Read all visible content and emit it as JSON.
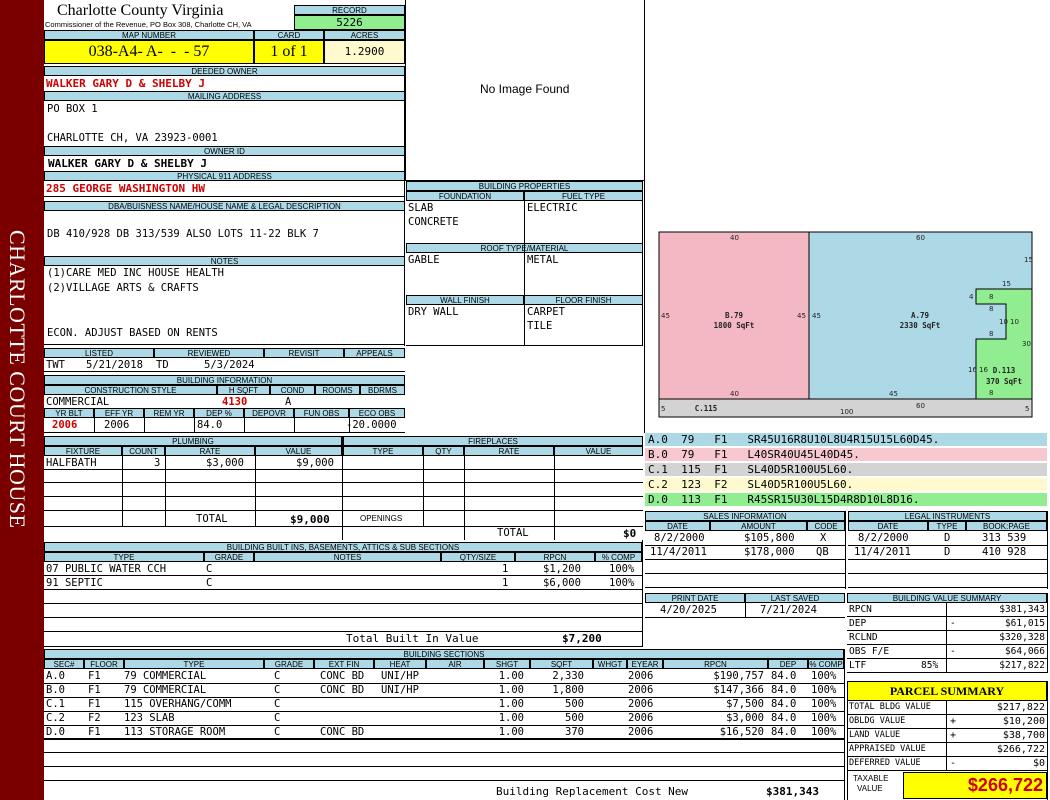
{
  "header": {
    "county": "Charlotte County Virginia",
    "commissioner": "Commissioner of the Revenue, PO Box 308, Charlotte CH, VA",
    "record_label": "RECORD",
    "record": "5226",
    "map_label": "MAP NUMBER",
    "map_number": "038-A4- A-  -  - 57",
    "card_label": "CARD",
    "card": "1 of 1",
    "acres_label": "ACRES",
    "acres": "1.2900"
  },
  "sidebar": {
    "text": "CHARLOTTE COURT HOUSE"
  },
  "owner": {
    "deeded_label": "DEEDED OWNER",
    "deeded": "WALKER GARY D & SHELBY J",
    "mailing_label": "MAILING ADDRESS",
    "mail_line1": "PO BOX 1",
    "mail_line2": "CHARLOTTE CH, VA 23923-0001",
    "owner_id_label": "OWNER ID",
    "owner_id": "WALKER GARY D & SHELBY J",
    "address_label": "PHYSICAL 911 ADDRESS",
    "address": "285 GEORGE WASHINGTON HW",
    "dba_label": "DBA/BUISNESS NAME/HOUSE NAME & LEGAL DESCRIPTION",
    "legal": "DB 410/928 DB 313/539 ALSO LOTS 11-22 BLK 7",
    "notes_label": "NOTES",
    "note1": "(1)CARE MED INC HOUSE HEALTH",
    "note2": "(2)VILLAGE ARTS & CRAFTS",
    "note3": "ECON. ADJUST BASED ON RENTS"
  },
  "photo": {
    "text": "No Image Found"
  },
  "review": {
    "listed_label": "LISTED",
    "reviewed_label": "REVIEWED",
    "revisit_label": "REVISIT",
    "appeals_label": "APPEALS",
    "listed_by": "TWT",
    "listed_date": "5/21/2018",
    "reviewed_by": "TD",
    "reviewed_date": "5/3/2024"
  },
  "building_info": {
    "title": "BUILDING INFORMATION",
    "construction_label": "CONSTRUCTION STYLE",
    "hsqft_label": "H SQFT",
    "cond_label": "COND",
    "rooms_label": "ROOMS",
    "bdrms_label": "BDRMS",
    "construction": "COMMERCIAL",
    "hsqft": "4130",
    "cond": "A",
    "yrblt_label": "YR BLT",
    "effyr_label": "EFF YR",
    "remyr_label": "REM YR",
    "dep_label": "DEP %",
    "depovr_label": "DEPOVR",
    "funobs_label": "FUN OBS",
    "ecoobs_label": "ECO OBS",
    "yrblt": "2006",
    "effyr": "2006",
    "dep": "84.0",
    "ecoobs": "-20.0000"
  },
  "properties": {
    "title": "BUILDING PROPERTIES",
    "foundation_label": "FOUNDATION",
    "fuel_label": "FUEL TYPE",
    "foundation1": "SLAB",
    "foundation2": "CONCRETE",
    "fuel": "ELECTRIC",
    "roof_label": "ROOF TYPE/MATERIAL",
    "roof_type": "GABLE",
    "roof_material": "METAL",
    "wall_label": "WALL FINISH",
    "floor_label": "FLOOR FINISH",
    "wall": "DRY WALL",
    "floor1": "CARPET",
    "floor2": "TILE"
  },
  "sketch": {
    "b_label": "B.79",
    "b_area": "1800 SqFt",
    "a_label": "A.79",
    "a_area": "2330 SqFt",
    "d_label": "D.113",
    "d_area": "370 SqFt",
    "c_label": "C.115",
    "dims": {
      "b_top": "40",
      "b_left": "45",
      "b_right": "45",
      "b_bottom": "40",
      "a_top": "60",
      "a_left": "45",
      "a_bottom": "45",
      "a_bottom2": "60",
      "a_right": "15",
      "d_15": "15",
      "d_4": "4",
      "d_8a": "8",
      "d_8b": "8",
      "d_10a": "10",
      "d_10b": "10",
      "d_8c": "8",
      "d_30": "30",
      "d_16a": "16",
      "d_16b": "16",
      "d_8d": "8",
      "c_5a": "5",
      "c_100": "100",
      "c_5b": "5"
    },
    "colors": {
      "b": "#f4b8c4",
      "a": "#add8e6",
      "d": "#90ee90",
      "c": "#d3d3d3"
    }
  },
  "sections_legend": [
    {
      "text": "A.0  79   F1   SR45U16R8U10L8U4R15U15L60D45.",
      "color": "#add8e6"
    },
    {
      "text": "B.0  79   F1   L40SR40U45L40D45.",
      "color": "#f8c8d0"
    },
    {
      "text": "C.1  115  F1   SL40D5R100U5L60.",
      "color": "#d3d3d3"
    },
    {
      "text": "C.2  123  F2   SL40D5R100U5L60.",
      "color": "#fffacd"
    },
    {
      "text": "D.0  113  F1   R45SR15U30L15D4R8D10L8D16.",
      "color": "#90ee90"
    }
  ],
  "plumbing": {
    "title": "PLUMBING",
    "cols": [
      "FIXTURE",
      "COUNT",
      "RATE",
      "VALUE"
    ],
    "rows": [
      {
        "fixture": "HALFBATH",
        "count": "3",
        "rate": "$3,000",
        "value": "$9,000"
      }
    ],
    "total_label": "TOTAL",
    "total": "$9,000"
  },
  "fireplaces": {
    "title": "FIREPLACES",
    "cols": [
      "TYPE",
      "QTY",
      "RATE",
      "VALUE"
    ],
    "openings_label": "OPENINGS",
    "total_label": "TOTAL",
    "total": "$0"
  },
  "sales": {
    "title": "SALES INFORMATION",
    "cols": [
      "DATE",
      "AMOUNT",
      "CODE"
    ],
    "rows": [
      {
        "date": "8/2/2000",
        "amount": "$105,800",
        "code": "X"
      },
      {
        "date": "11/4/2011",
        "amount": "$178,000",
        "code": "QB"
      }
    ]
  },
  "legal": {
    "title": "LEGAL INSTRUMENTS",
    "cols": [
      "DATE",
      "TYPE",
      "BOOK:PAGE"
    ],
    "rows": [
      {
        "date": "8/2/2000",
        "type": "D",
        "book": "313 539"
      },
      {
        "date": "11/4/2011",
        "type": "D",
        "book": "410 928"
      }
    ]
  },
  "builtins": {
    "title": "BUILDING BUILT INS, BASEMENTS, ATTICS & SUB SECTIONS",
    "cols": [
      "TYPE",
      "GRADE",
      "NOTES",
      "QTY/SIZE",
      "RPCN",
      "% COMP"
    ],
    "rows": [
      {
        "type": "07 PUBLIC WATER CCH",
        "grade": "C",
        "qty": "1",
        "rpcn": "$1,200",
        "comp": "100%"
      },
      {
        "type": "91 SEPTIC",
        "grade": "C",
        "qty": "1",
        "rpcn": "$6,000",
        "comp": "100%"
      }
    ],
    "total_label": "Total Built In Value",
    "total": "$7,200"
  },
  "print": {
    "print_label": "PRINT DATE",
    "saved_label": "LAST SAVED",
    "print_date": "4/20/2025",
    "saved_date": "7/21/2024"
  },
  "value_summary": {
    "title": "BUILDING VALUE SUMMARY",
    "rows": [
      {
        "label": "RPCN",
        "sign": "",
        "value": "$381,343"
      },
      {
        "label": "DEP",
        "sign": "-",
        "value": "$61,015"
      },
      {
        "label": "RCLND",
        "sign": "",
        "value": "$320,328"
      },
      {
        "label": "OBS F/E",
        "sign": "-",
        "value": "$64,066"
      },
      {
        "label": "LTF",
        "sign": "85%",
        "value": "$217,822"
      }
    ]
  },
  "parcel": {
    "title": "PARCEL SUMMARY",
    "rows": [
      {
        "label": "TOTAL BLDG VALUE",
        "sign": "",
        "value": "$217,822"
      },
      {
        "label": "OBLDG VALUE",
        "sign": "+",
        "value": "$10,200"
      },
      {
        "label": "LAND VALUE",
        "sign": "+",
        "value": "$38,700"
      },
      {
        "label": "APPRAISED VALUE",
        "sign": "",
        "value": "$266,722"
      },
      {
        "label": "DEFERRED VALUE",
        "sign": "-",
        "value": "$0"
      }
    ],
    "taxable_label1": "TAXABLE",
    "taxable_label2": "VALUE",
    "taxable": "$266,722"
  },
  "sections": {
    "title": "BUILDING SECTIONS",
    "cols": [
      "SEC#",
      "FLOOR",
      "TYPE",
      "GRADE",
      "EXT FIN",
      "HEAT",
      "AIR",
      "SHGT",
      "SQFT",
      "WHGT",
      "EYEAR",
      "RPCN",
      "DEP",
      "% COMP"
    ],
    "rows": [
      {
        "sec": "A.0",
        "floor": "F1",
        "type": "79 COMMERCIAL",
        "grade": "C",
        "ext": "CONC BD",
        "heat": "UNI/HP",
        "shgt": "1.00",
        "sqft": "2,330",
        "eyear": "2006",
        "rpcn": "$190,757",
        "dep": "84.0",
        "comp": "100%"
      },
      {
        "sec": "B.0",
        "floor": "F1",
        "type": "79 COMMERCIAL",
        "grade": "C",
        "ext": "CONC BD",
        "heat": "UNI/HP",
        "shgt": "1.00",
        "sqft": "1,800",
        "eyear": "2006",
        "rpcn": "$147,366",
        "dep": "84.0",
        "comp": "100%"
      },
      {
        "sec": "C.1",
        "floor": "F1",
        "type": "115 OVERHANG/COMM",
        "grade": "C",
        "ext": "",
        "heat": "",
        "shgt": "1.00",
        "sqft": "500",
        "eyear": "2006",
        "rpcn": "$7,500",
        "dep": "84.0",
        "comp": "100%"
      },
      {
        "sec": "C.2",
        "floor": "F2",
        "type": "123 SLAB",
        "grade": "C",
        "ext": "",
        "heat": "",
        "shgt": "1.00",
        "sqft": "500",
        "eyear": "2006",
        "rpcn": "$3,000",
        "dep": "84.0",
        "comp": "100%"
      },
      {
        "sec": "D.0",
        "floor": "F1",
        "type": "113 STORAGE ROOM",
        "grade": "C",
        "ext": "CONC BD",
        "heat": "",
        "shgt": "1.00",
        "sqft": "370",
        "eyear": "2006",
        "rpcn": "$16,520",
        "dep": "84.0",
        "comp": "100%"
      }
    ],
    "total_label": "Building Replacement Cost New",
    "total": "$381,343"
  }
}
